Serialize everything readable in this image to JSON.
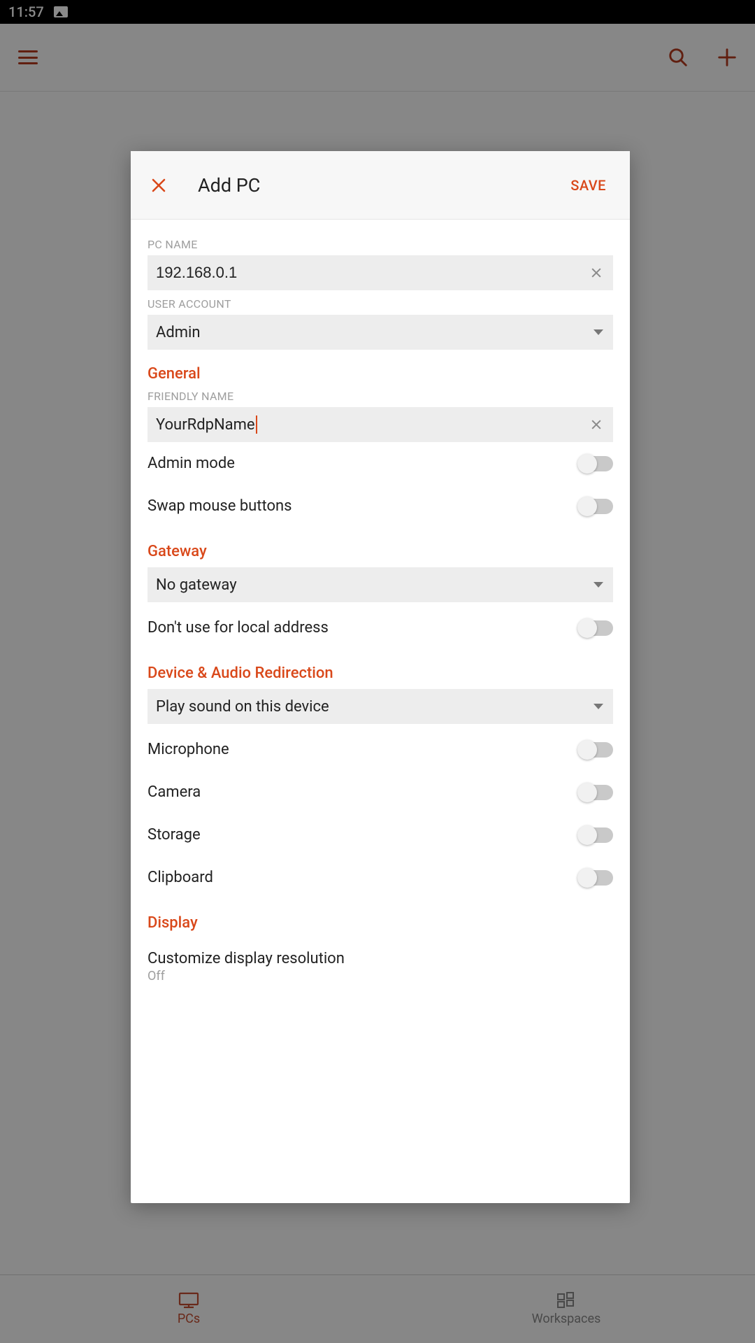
{
  "status": {
    "time": "11:57"
  },
  "appbar": {},
  "bottomnav": {
    "pcs": "PCs",
    "workspaces": "Workspaces"
  },
  "dialog": {
    "title": "Add PC",
    "save": "SAVE",
    "pc_name_label": "PC NAME",
    "pc_name_value": "192.168.0.1",
    "user_account_label": "USER ACCOUNT",
    "user_account_value": "Admin",
    "section_general": "General",
    "friendly_name_label": "FRIENDLY NAME",
    "friendly_name_value": "YourRdpName",
    "admin_mode": "Admin mode",
    "swap_mouse": "Swap mouse buttons",
    "section_gateway": "Gateway",
    "gateway_value": "No gateway",
    "dont_use_local": "Don't use for local address",
    "section_device": "Device & Audio Redirection",
    "sound_value": "Play sound on this device",
    "microphone": "Microphone",
    "camera": "Camera",
    "storage": "Storage",
    "clipboard": "Clipboard",
    "section_display": "Display",
    "customize_resolution": "Customize display resolution",
    "customize_resolution_value": "Off"
  }
}
